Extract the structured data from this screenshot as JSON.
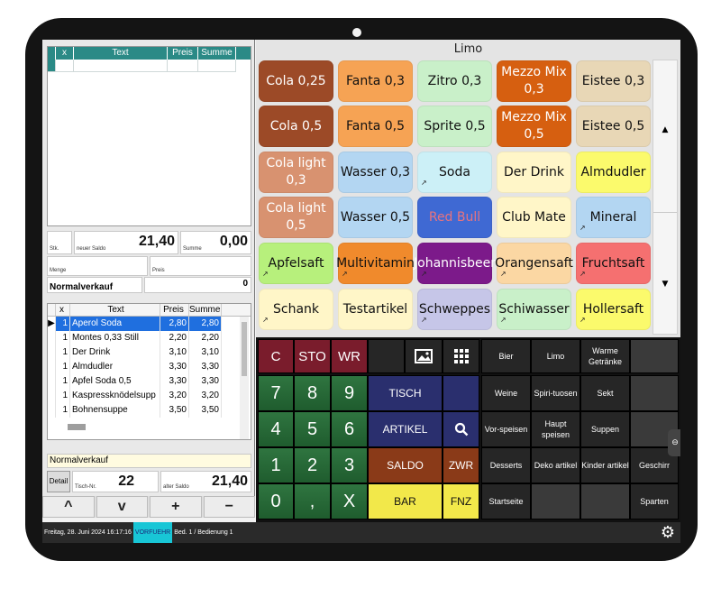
{
  "category_title": "Limo",
  "bill_top": {
    "headers": [
      "",
      "x",
      "Text",
      "Preis",
      "Summe"
    ]
  },
  "summary": {
    "stk_label": "Stk.",
    "saldo_label": "neuer Saldo",
    "saldo_value": "21,40",
    "summe_label": "Summe",
    "summe_value": "0,00",
    "menge_label": "Menge",
    "preis_label": "Preis",
    "sale_type": "Normalverkauf",
    "zero_value": "0"
  },
  "bill_items": {
    "headers": [
      "",
      "x",
      "Text",
      "Preis",
      "Summe"
    ],
    "rows": [
      {
        "x": "1",
        "text": "Aperol Soda",
        "price": "2,80",
        "sum": "2,80",
        "selected": true
      },
      {
        "x": "1",
        "text": "Montes 0,33 Still",
        "price": "2,20",
        "sum": "2,20"
      },
      {
        "x": "1",
        "text": "Der Drink",
        "price": "3,10",
        "sum": "3,10"
      },
      {
        "x": "1",
        "text": "Almdudler",
        "price": "3,30",
        "sum": "3,30"
      },
      {
        "x": "1",
        "text": "Apfel Soda 0,5",
        "price": "3,30",
        "sum": "3,30"
      },
      {
        "x": "1",
        "text": "Kaspressknödelsupp",
        "price": "3,20",
        "sum": "3,20"
      },
      {
        "x": "1",
        "text": "Bohnensuppe",
        "price": "3,50",
        "sum": "3,50"
      }
    ],
    "sale_type": "Normalverkauf"
  },
  "totals": {
    "detail_label": "Detail",
    "tisch_label": "Tisch-Nr.",
    "tisch_value": "22",
    "saldo_label": "alter Saldo",
    "saldo_value": "21,40"
  },
  "arrows": [
    "^",
    "v",
    "+",
    "−"
  ],
  "status": {
    "datetime": "Freitag, 28. Juni 2024 16:17:16",
    "mode": "VORFUEHR",
    "user": "Bed. 1 / Bedienung 1"
  },
  "products": [
    {
      "label": "Cola 0,25",
      "color": "#9c4a27",
      "text": "#ffffff"
    },
    {
      "label": "Fanta 0,3",
      "color": "#f6a354",
      "text": "#111111"
    },
    {
      "label": "Zitro 0,3",
      "color": "#c9f0c9",
      "text": "#111111"
    },
    {
      "label": "Mezzo Mix 0,3",
      "color": "#d65f10",
      "text": "#ffffff"
    },
    {
      "label": "Eistee 0,3",
      "color": "#e8d7b6",
      "text": "#111111"
    },
    {
      "label": "Cola 0,5",
      "color": "#9c4a27",
      "text": "#ffffff"
    },
    {
      "label": "Fanta 0,5",
      "color": "#f6a354",
      "text": "#111111"
    },
    {
      "label": "Sprite 0,5",
      "color": "#c9f0c9",
      "text": "#111111"
    },
    {
      "label": "Mezzo Mix 0,5",
      "color": "#d65f10",
      "text": "#ffffff"
    },
    {
      "label": "Eistee 0,5",
      "color": "#e8d7b6",
      "text": "#111111"
    },
    {
      "label": "Cola light 0,3",
      "color": "#d89270",
      "text": "#ffffff"
    },
    {
      "label": "Wasser 0,3",
      "color": "#b3d6f2",
      "text": "#111111"
    },
    {
      "label": "Soda",
      "color": "#ccf0f7",
      "text": "#111111",
      "corner": "↗"
    },
    {
      "label": "Der Drink",
      "color": "#fff6c8",
      "text": "#111111"
    },
    {
      "label": "Almdudler",
      "color": "#fbfa6c",
      "text": "#111111"
    },
    {
      "label": "Cola light 0,5",
      "color": "#d89270",
      "text": "#ffffff"
    },
    {
      "label": "Wasser 0,5",
      "color": "#b3d6f2",
      "text": "#111111"
    },
    {
      "label": "Red Bull",
      "color": "#3f69d3",
      "text": "#e7737e"
    },
    {
      "label": "Club Mate",
      "color": "#fff6c8",
      "text": "#111111"
    },
    {
      "label": "Mineral",
      "color": "#b3d6f2",
      "text": "#111111",
      "corner": "↗"
    },
    {
      "label": "Apfelsaft",
      "color": "#b7f07c",
      "text": "#111111",
      "corner": "↗"
    },
    {
      "label": "Multivitamin",
      "color": "#f08a2c",
      "text": "#111111",
      "corner": "↗"
    },
    {
      "label": "Johannisbeer",
      "color": "#7c1a8a",
      "text": "#ffffff",
      "corner": "↗"
    },
    {
      "label": "Orangensaft",
      "color": "#fbd7a3",
      "text": "#111111",
      "corner": "↗"
    },
    {
      "label": "Fruchtsaft",
      "color": "#f57070",
      "text": "#111111",
      "corner": "↗"
    },
    {
      "label": "Schank",
      "color": "#fff6c8",
      "text": "#111111",
      "corner": "↗"
    },
    {
      "label": "Testartikel",
      "color": "#fff6c8",
      "text": "#111111"
    },
    {
      "label": "Schweppes",
      "color": "#c6c6e8",
      "text": "#111111",
      "corner": "↗"
    },
    {
      "label": "Schiwasser",
      "color": "#c9f0c9",
      "text": "#111111",
      "corner": "↗"
    },
    {
      "label": "Hollersaft",
      "color": "#fbfa6c",
      "text": "#111111",
      "corner": "↗"
    }
  ],
  "keypad": {
    "c": "C",
    "sto": "STO",
    "wr": "WR",
    "digits": [
      "7",
      "8",
      "9",
      "4",
      "5",
      "6",
      "1",
      "2",
      "3",
      "0",
      ",",
      "X"
    ],
    "tisch": "TISCH",
    "artikel": "ARTIKEL",
    "saldo": "SALDO",
    "bar": "BAR",
    "zwr": "ZWR",
    "fnz": "FNZ"
  },
  "categories": [
    "Bier",
    "Limo",
    "Warme Getränke",
    "Weine",
    "Spiri-tuosen",
    "Sekt",
    "Vor-speisen",
    "Haupt speisen",
    "Suppen",
    "Desserts",
    "Deko artikel",
    "Kinder artikel",
    "Geschirr",
    "Startseite",
    "Sparten"
  ]
}
